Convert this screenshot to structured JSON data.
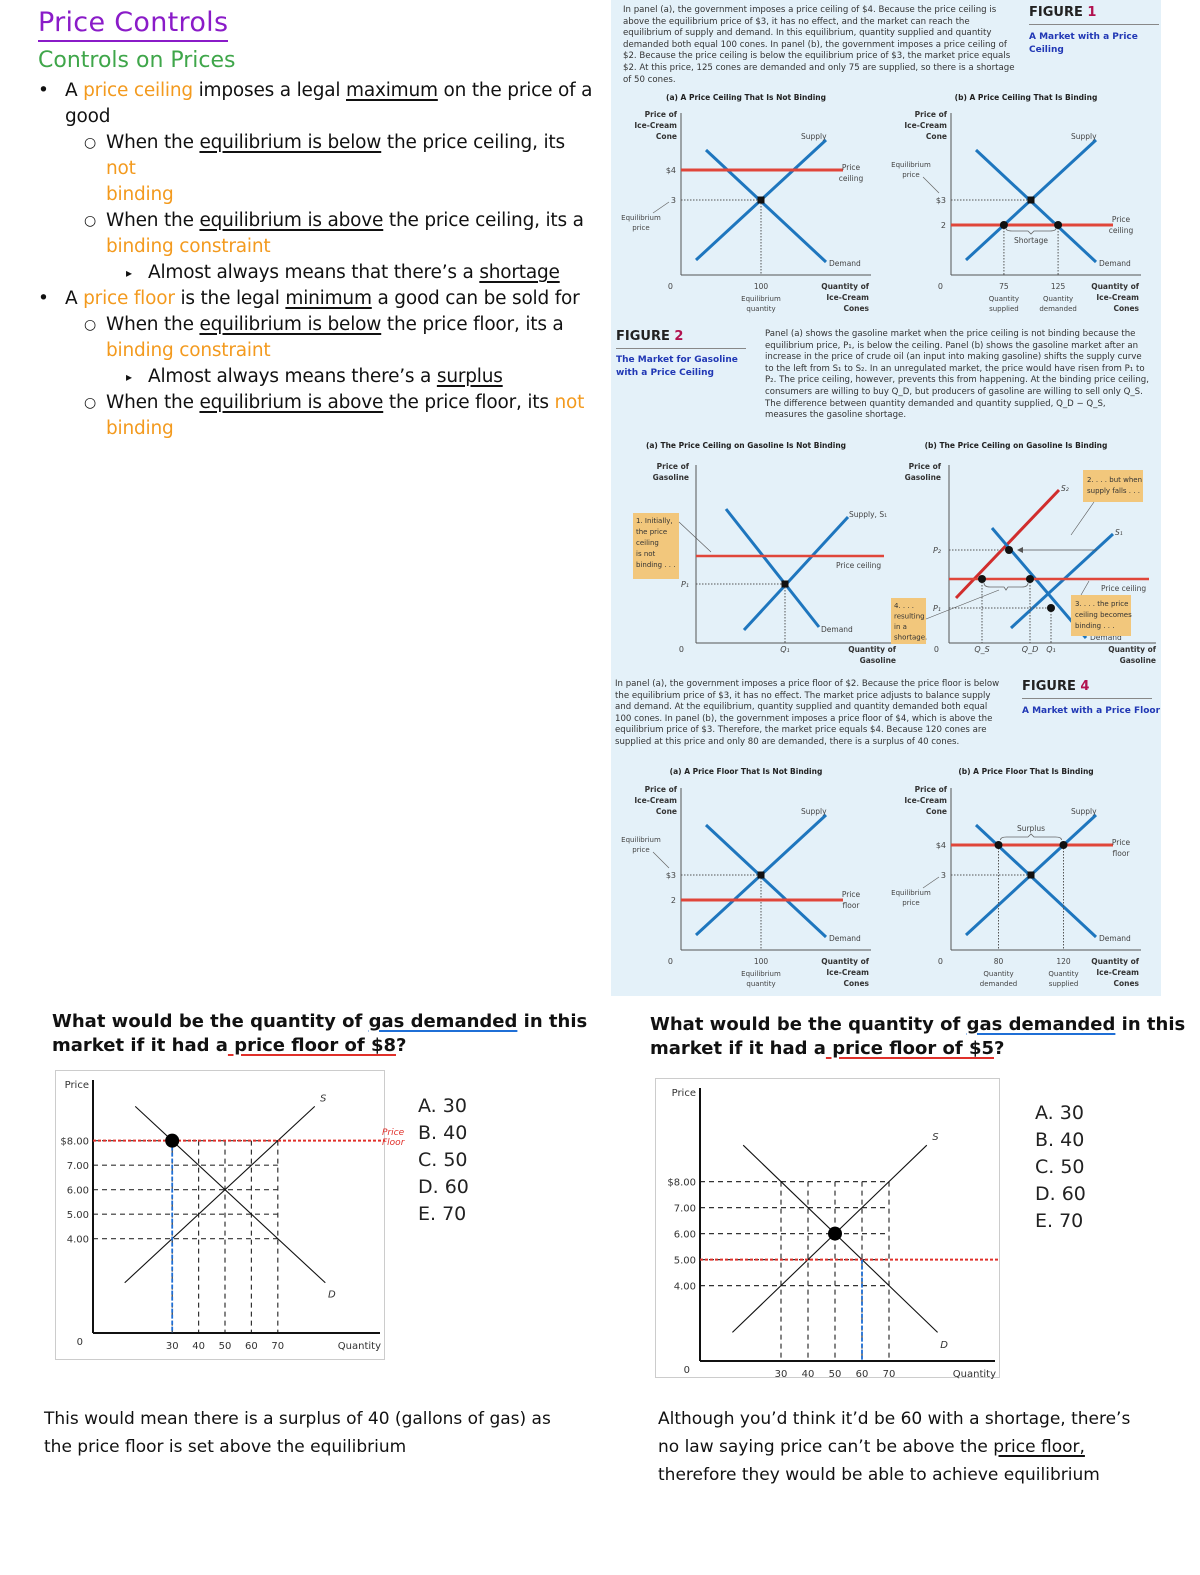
{
  "notes": {
    "title": "Price Controls",
    "subtitle": "Controls on Prices",
    "items": [
      {
        "level": 1,
        "bullet": "•",
        "parts": [
          {
            "t": "A "
          },
          {
            "t": "price ceiling",
            "c": "org"
          },
          {
            "t": " imposes a legal "
          },
          {
            "t": "maximum",
            "c": "ul"
          },
          {
            "t": " on the price of a"
          }
        ]
      },
      {
        "level": 1,
        "bullet": "",
        "parts": [
          {
            "t": "good"
          }
        ]
      },
      {
        "level": 2,
        "bullet": "○",
        "parts": [
          {
            "t": "When the "
          },
          {
            "t": "equilibrium is below",
            "c": "ul"
          },
          {
            "t": " the price ceiling, its "
          },
          {
            "t": "not",
            "c": "org"
          }
        ]
      },
      {
        "level": 2,
        "bullet": "",
        "parts": [
          {
            "t": "binding",
            "c": "org"
          }
        ]
      },
      {
        "level": 2,
        "bullet": "○",
        "parts": [
          {
            "t": "When the "
          },
          {
            "t": "equilibrium is above",
            "c": "ul"
          },
          {
            "t": " the price ceiling, its a"
          }
        ]
      },
      {
        "level": 2,
        "bullet": "",
        "parts": [
          {
            "t": "binding constraint",
            "c": "org"
          }
        ]
      },
      {
        "level": 3,
        "bullet": "▸",
        "parts": [
          {
            "t": "Almost always means that there’s a "
          },
          {
            "t": "shortage",
            "c": "ul"
          }
        ]
      },
      {
        "level": 1,
        "bullet": "•",
        "parts": [
          {
            "t": "A "
          },
          {
            "t": "price floor",
            "c": "org"
          },
          {
            "t": " is the legal "
          },
          {
            "t": "minimum",
            "c": "ul"
          },
          {
            "t": " a good can be sold for"
          }
        ]
      },
      {
        "level": 2,
        "bullet": "○",
        "parts": [
          {
            "t": "When the "
          },
          {
            "t": "equilibrium is below",
            "c": "ul"
          },
          {
            "t": " the price floor, its a"
          }
        ]
      },
      {
        "level": 2,
        "bullet": "",
        "parts": [
          {
            "t": "binding constraint",
            "c": "org"
          }
        ]
      },
      {
        "level": 3,
        "bullet": "▸",
        "parts": [
          {
            "t": "Almost always means there’s a "
          },
          {
            "t": "surplus",
            "c": "ul"
          }
        ]
      },
      {
        "level": 2,
        "bullet": "○",
        "parts": [
          {
            "t": "When the "
          },
          {
            "t": "equilibrium is above",
            "c": "ul"
          },
          {
            "t": " the price floor, its "
          },
          {
            "t": "not",
            "c": "org"
          }
        ]
      },
      {
        "level": 2,
        "bullet": "",
        "parts": [
          {
            "t": "binding",
            "c": "org"
          }
        ]
      }
    ]
  },
  "figure1": {
    "label": "FIGURE",
    "number": "1",
    "subtitle": "A Market with a Price Ceiling",
    "caption": "In panel (a), the government imposes a price ceiling of $4. Because the price ceiling is above the equilibrium price of $3, it has no effect, and the market can reach the equilibrium of supply and demand. In this equilibrium, quantity supplied and quantity demanded both equal 100 cones. In panel (b), the government imposes a price ceiling of $2. Because the price ceiling is below the equilibrium price of $3, the market price equals $2. At this price, 125 cones are demanded and only 75 are supplied, so there is a shortage of 50 cones.",
    "panel_a": {
      "title": "(a) A Price Ceiling That Is Not Binding",
      "y_label": [
        "Price of",
        "Ice-Cream",
        "Cone"
      ],
      "x_label": [
        "Quantity of",
        "Ice-Cream",
        "Cones"
      ],
      "origin": "0",
      "control_price": "$4",
      "eq_price": "3",
      "eq_price_label": [
        "Equilibrium",
        "price"
      ],
      "eq_qty": "100",
      "eq_qty_label": [
        "Equilibrium",
        "quantity"
      ],
      "supply": "Supply",
      "demand": "Demand",
      "control_label": [
        "Price",
        "ceiling"
      ]
    },
    "panel_b": {
      "title": "(b) A Price Ceiling That Is Binding",
      "y_label": [
        "Price of",
        "Ice-Cream",
        "Cone"
      ],
      "x_label": [
        "Quantity of",
        "Ice-Cream",
        "Cones"
      ],
      "origin": "0",
      "eq_price": "$3",
      "eq_price_label": [
        "Equilibrium",
        "price"
      ],
      "control_price": "2",
      "q1": "75",
      "q1_label": [
        "Quantity",
        "supplied"
      ],
      "q2": "125",
      "q2_label": [
        "Quantity",
        "demanded"
      ],
      "gap_label": "Shortage",
      "supply": "Supply",
      "demand": "Demand",
      "control_label": [
        "Price",
        "ceiling"
      ]
    }
  },
  "figure2": {
    "label": "FIGURE",
    "number": "2",
    "subtitle": [
      "The Market for Gasoline",
      "with a Price Ceiling"
    ],
    "caption": "Panel (a) shows the gasoline market when the price ceiling is not binding because the equilibrium price, P₁, is below the ceiling. Panel (b) shows the gasoline market after an increase in the price of crude oil (an input into making gasoline) shifts the supply curve to the left from S₁ to S₂. In an unregulated market, the price would have risen from P₁ to P₂. The price ceiling, however, prevents this from happening. At the binding price ceiling, consumers are willing to buy Q_D, but producers of gasoline are willing to sell only Q_S. The difference between quantity demanded and quantity supplied, Q_D − Q_S, measures the gasoline shortage.",
    "panel_a": {
      "title": "(a) The Price Ceiling on Gasoline Is Not Binding",
      "y_label": [
        "Price of",
        "Gasoline"
      ],
      "x_label": [
        "Quantity of",
        "Gasoline"
      ],
      "origin": "0",
      "p1": "P₁",
      "q1": "Q₁",
      "supply": "Supply, S₁",
      "demand": "Demand",
      "ceiling": "Price ceiling",
      "note": [
        "1. Initially,",
        "the price",
        "ceiling",
        "is not",
        "binding . . ."
      ]
    },
    "panel_b": {
      "title": "(b) The Price Ceiling on Gasoline Is Binding",
      "y_label": [
        "Price of",
        "Gasoline"
      ],
      "x_label": [
        "Quantity of",
        "Gasoline"
      ],
      "origin": "0",
      "p1": "P₁",
      "p2": "P₂",
      "qs": "Q_S",
      "qd": "Q_D",
      "q1": "Q₁",
      "s1": "S₁",
      "s2": "S₂",
      "demand": "Demand",
      "ceiling": "Price ceiling",
      "note2": [
        "2. . . . but when",
        "supply falls . . ."
      ],
      "note3": [
        "3. . . . the price",
        "ceiling becomes",
        "binding . . ."
      ],
      "note4": [
        "4. . . .",
        "resulting",
        "in a",
        "shortage."
      ]
    }
  },
  "figure4": {
    "label": "FIGURE",
    "number": "4",
    "subtitle": "A Market with a Price Floor",
    "caption": "In panel (a), the government imposes a price floor of $2. Because the price floor is below the equilibrium price of $3, it has no effect. The market price adjusts to balance supply and demand. At the equilibrium, quantity supplied and quantity demanded both equal 100 cones. In panel (b), the government imposes a price floor of $4, which is above the equilibrium price of $3. Therefore, the market price equals $4. Because 120 cones are supplied at this price and only 80 are demanded, there is a surplus of 40 cones.",
    "panel_a": {
      "title": "(a) A Price Floor That Is Not Binding",
      "y_label": [
        "Price of",
        "Ice-Cream",
        "Cone"
      ],
      "x_label": [
        "Quantity of",
        "Ice-Cream",
        "Cones"
      ],
      "origin": "0",
      "eq_price": "$3",
      "eq_price_label": [
        "Equilibrium",
        "price"
      ],
      "control_price": "2",
      "eq_qty": "100",
      "eq_qty_label": [
        "Equilibrium",
        "quantity"
      ],
      "supply": "Supply",
      "demand": "Demand",
      "control_label": [
        "Price",
        "floor"
      ]
    },
    "panel_b": {
      "title": "(b) A Price Floor That Is Binding",
      "y_label": [
        "Price of",
        "Ice-Cream",
        "Cone"
      ],
      "x_label": [
        "Quantity of",
        "Ice-Cream",
        "Cones"
      ],
      "origin": "0",
      "control_price": "$4",
      "eq_price": "3",
      "eq_price_label": [
        "Equilibrium",
        "price"
      ],
      "q1": "80",
      "q1_label": [
        "Quantity",
        "demanded"
      ],
      "q2": "120",
      "q2_label": [
        "Quantity",
        "supplied"
      ],
      "gap_label": "Surplus",
      "supply": "Supply",
      "demand": "Demand",
      "control_label": [
        "Price",
        "floor"
      ]
    }
  },
  "question1": {
    "title_pre": "What would be the quantity of ",
    "title_ul_blue": "gas demanded",
    "title_mid": " in this",
    "title_line2_pre": "market if it had a",
    "title_ul_red": " price floor of $8",
    "title_end": "?",
    "floor_annotation": [
      "Price",
      "Floor"
    ],
    "options": [
      "A.  30",
      "B.  40",
      "C.  50",
      "D.  60",
      "E.  70"
    ],
    "answer_note": "This would mean there is a surplus of 40 (gallons of gas) as the price floor is set above the equilibrium"
  },
  "question2": {
    "title_pre": "What would be the quantity of ",
    "title_ul_blue": "gas demanded",
    "title_mid": " in this",
    "title_line2_pre": "market if it had a",
    "title_ul_red": " price floor of $5",
    "title_end": "?",
    "options": [
      "A.  30",
      "B.  40",
      "C.  50",
      "D.  60",
      "E.  70"
    ],
    "answer_note_pre": "Although you’d think it’d be 60 with a shortage, there’s no law saying price can’t be above the ",
    "answer_note_ul": "price floor,",
    "answer_note_post": " therefore they would be able to achieve equilibrium"
  },
  "colors": {
    "title_purple": "#8a1bc8",
    "subtitle_green": "#3fa64a",
    "highlight_orange": "#f39a1e",
    "curve_blue": "#1e76be",
    "control_red": "#e0463a",
    "figure_number": "#b1124f",
    "figure_subtitle": "#2138b5",
    "book_bg": "#e4f1f9",
    "note_box": "#f2c77c"
  },
  "chart_data": [
    {
      "type": "line",
      "title": "What would be the quantity of gas demanded in this market if it had a price floor of $8?",
      "xlabel": "Quantity",
      "ylabel": "Price",
      "x_ticks": [
        "30",
        "40",
        "50",
        "60",
        "70"
      ],
      "y_ticks": [
        "4.00",
        "5.00",
        "6.00",
        "7.00",
        "$8.00"
      ],
      "xlim": [
        0,
        90
      ],
      "ylim": [
        0,
        10
      ],
      "series": [
        {
          "name": "S",
          "points": [
            [
              30,
              4
            ],
            [
              40,
              5
            ],
            [
              50,
              6
            ],
            [
              60,
              7
            ],
            [
              70,
              8
            ]
          ]
        },
        {
          "name": "D",
          "points": [
            [
              30,
              8
            ],
            [
              40,
              7
            ],
            [
              50,
              6
            ],
            [
              60,
              5
            ],
            [
              70,
              4
            ]
          ]
        }
      ],
      "price_floor": 8,
      "highlight_point": [
        30,
        8
      ],
      "highlight_qty": 30
    },
    {
      "type": "line",
      "title": "What would be the quantity of gas demanded in this market if it had a price floor of $5?",
      "xlabel": "Quantity",
      "ylabel": "Price",
      "x_ticks": [
        "30",
        "40",
        "50",
        "60",
        "70"
      ],
      "y_ticks": [
        "4.00",
        "5.00",
        "6.00",
        "7.00",
        "$8.00"
      ],
      "xlim": [
        0,
        90
      ],
      "ylim": [
        0,
        10
      ],
      "series": [
        {
          "name": "S",
          "points": [
            [
              30,
              4
            ],
            [
              40,
              5
            ],
            [
              50,
              6
            ],
            [
              60,
              7
            ],
            [
              70,
              8
            ]
          ]
        },
        {
          "name": "D",
          "points": [
            [
              30,
              8
            ],
            [
              40,
              7
            ],
            [
              50,
              6
            ],
            [
              60,
              5
            ],
            [
              70,
              4
            ]
          ]
        }
      ],
      "price_floor": 5,
      "highlight_point": [
        50,
        6
      ],
      "highlight_qty": 60
    }
  ]
}
